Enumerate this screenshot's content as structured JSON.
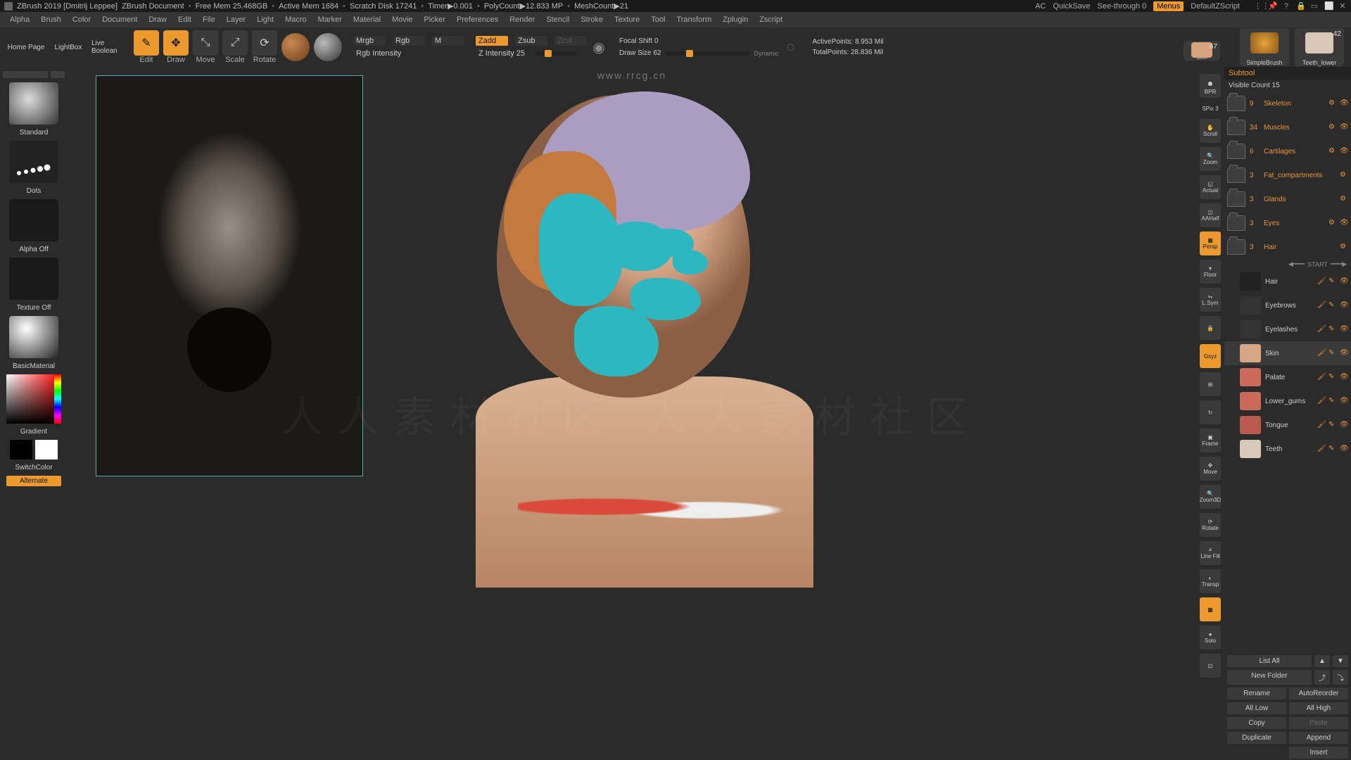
{
  "titlebar": {
    "app": "ZBrush 2019 [Dmitrij Leppee]",
    "doc": "ZBrush Document",
    "stats": {
      "freemem": "Free Mem 25.468GB",
      "activemem": "Active Mem 1684",
      "scratch": "Scratch Disk 17241",
      "timer": "Timer▶0.001",
      "polycount": "PolyCount▶12.833 MP",
      "meshcount": "MeshCount▶21"
    },
    "right": {
      "ac": "AC",
      "quicksave": "QuickSave",
      "seethrough": "See-through  0",
      "menus": "Menus",
      "script": "DefaultZScript"
    }
  },
  "menu": [
    "Alpha",
    "Brush",
    "Color",
    "Document",
    "Draw",
    "Edit",
    "File",
    "Layer",
    "Light",
    "Macro",
    "Marker",
    "Material",
    "Movie",
    "Picker",
    "Preferences",
    "Render",
    "Stencil",
    "Stroke",
    "Texture",
    "Tool",
    "Transform",
    "Zplugin",
    "Zscript"
  ],
  "toolbar": {
    "home": "Home Page",
    "lightbox": "LightBox",
    "livebool": "Live Boolean",
    "edit": "Edit",
    "draw": "Draw",
    "move": "Move",
    "scale": "Scale",
    "rotate": "Rotate",
    "mrgb": "Mrgb",
    "rgb": "Rgb",
    "m": "M",
    "rgbint": "Rgb Intensity",
    "zadd": "Zadd",
    "zsub": "Zsub",
    "zcut": "Zcut",
    "zint_label": "Z Intensity 25",
    "focal_label": "Focal Shift 0",
    "drawsize_label": "Draw Size 62",
    "dynamic": "Dynamic",
    "activepoints": "ActivePoints: 8.953 Mil",
    "totalpoints": "TotalPoints: 28.836 Mil",
    "simplebrush": "SimpleBrush",
    "teeth": "Teeth_lower",
    "teeth_badge": "42",
    "skin": "Skin",
    "skin_badge": "67"
  },
  "left": {
    "standard": "Standard",
    "dots": "Dots",
    "alphaoff": "Alpha Off",
    "textureoff": "Texture Off",
    "basicmat": "BasicMaterial",
    "gradient": "Gradient",
    "switch": "SwitchColor",
    "alternate": "Alternate"
  },
  "rstrip": [
    "BPR",
    "SPix 3",
    "Scroll",
    "Zoom",
    "Actual",
    "AAHalf",
    "Persp",
    "Floor",
    "L.Sym",
    "",
    "",
    "Gxyz",
    "",
    "",
    "Frame",
    "Move",
    "Zoom3D",
    "Rotate",
    "Line Fill",
    "Transp",
    "Solo",
    ""
  ],
  "rpanel": {
    "title": "Subtool",
    "visible": "Visible Count 15",
    "folders": [
      {
        "count": "9",
        "name": "Skeleton",
        "eyes": true
      },
      {
        "count": "34",
        "name": "Muscles",
        "eyes": true
      },
      {
        "count": "6",
        "name": "Cartilages",
        "eyes": true
      },
      {
        "count": "3",
        "name": "Fat_compartments",
        "eyes": false
      },
      {
        "count": "3",
        "name": "Glands",
        "eyes": false
      },
      {
        "count": "3",
        "name": "Eyes",
        "eyes": true
      },
      {
        "count": "3",
        "name": "Hair",
        "eyes": false
      }
    ],
    "start": "START",
    "items": [
      "Hair",
      "Eyebrows",
      "Eyelashes",
      "Skin",
      "Palate",
      "Lower_gums",
      "Tongue",
      "Teeth"
    ],
    "buttons": {
      "listall": "List All",
      "newfolder": "New Folder",
      "rename": "Rename",
      "autoreorder": "AutoReorder",
      "alllow": "All Low",
      "allhigh": "All High",
      "copy": "Copy",
      "paste": "Paste",
      "duplicate": "Duplicate",
      "append": "Append",
      "insert": "Insert"
    }
  },
  "watermark": {
    "url": "www.rrcg.cn"
  }
}
